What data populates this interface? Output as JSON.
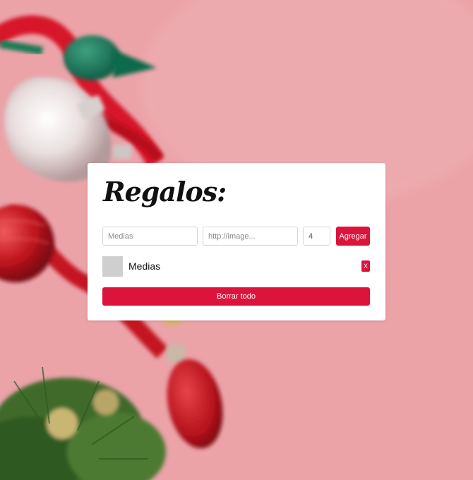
{
  "page": {
    "title": "Regalos:"
  },
  "form": {
    "name_placeholder": "Medias",
    "url_placeholder": "http://image...",
    "quantity_value": "4",
    "add_label": "Agregar"
  },
  "gifts": [
    {
      "name": "Medias",
      "delete_label": "X"
    }
  ],
  "actions": {
    "clear_all_label": "Borrar todo"
  },
  "colors": {
    "accent": "#dc143c",
    "background": "#eba3a8",
    "card": "#ffffff"
  },
  "icons": {
    "delete": "close-icon"
  }
}
